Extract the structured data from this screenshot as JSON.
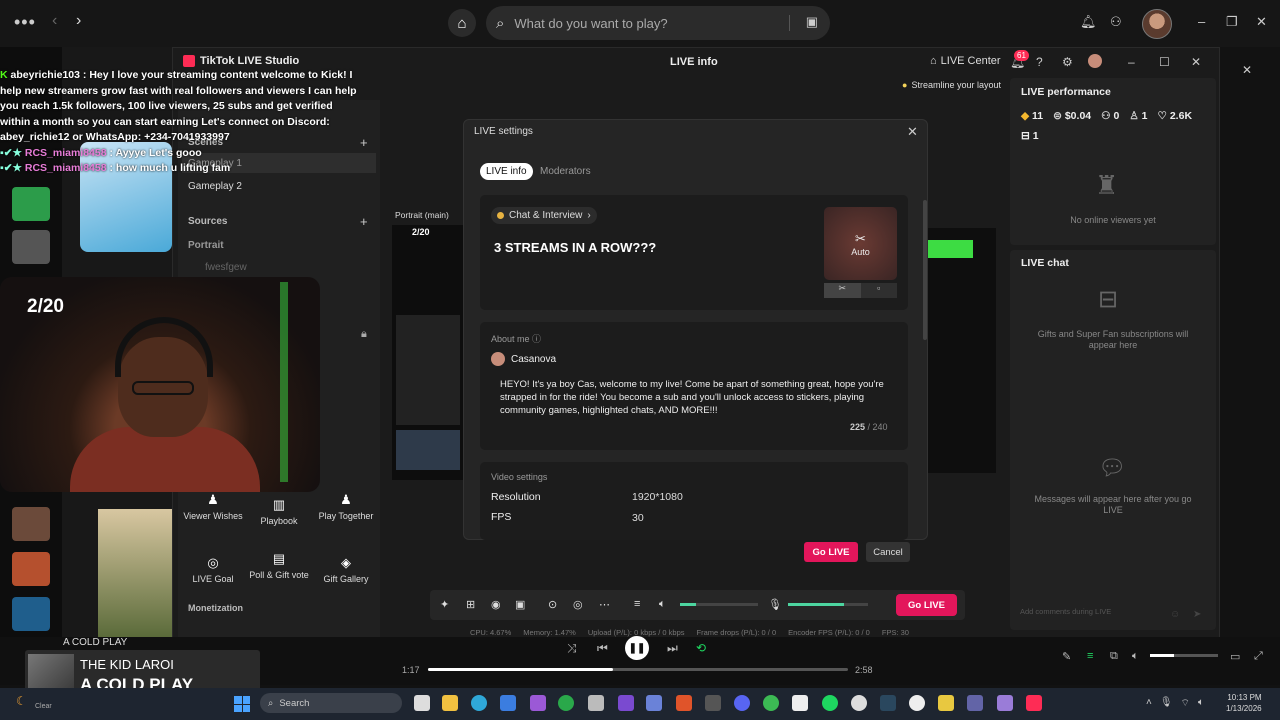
{
  "topbar": {
    "search_placeholder": "What do you want to play?"
  },
  "studio": {
    "app_title": "TikTok LIVE Studio",
    "window_title": "LIVE info",
    "live_center": "LIVE Center",
    "notif_count": "61",
    "streamline": "Streamline your layout",
    "scenes_label": "Scenes",
    "scene_items": [
      "Gameplay 1",
      "Gameplay 2"
    ],
    "sources_label": "Sources",
    "portrait_label": "Portrait",
    "source_item": "fwesfgew",
    "portrait_main": "Portrait (main)",
    "preview_counter": "2/20",
    "tools": [
      {
        "label": "Viewer Wishes",
        "icon": "viewer-wishes-icon"
      },
      {
        "label": "Playbook",
        "icon": "playbook-icon"
      },
      {
        "label": "Play Together",
        "icon": "play-together-icon"
      },
      {
        "label": "LIVE Goal",
        "icon": "live-goal-icon"
      },
      {
        "label": "Poll & Gift vote",
        "icon": "poll-icon"
      },
      {
        "label": "Gift Gallery",
        "icon": "gift-gallery-icon"
      }
    ],
    "monetization_label": "Monetization"
  },
  "chat_overlay": [
    {
      "user": "abeyrichie103",
      "text": " : Hey I love your streaming content welcome to Kick! I help new streamers grow fast with real followers and viewers I can help you reach 1.5k followers, 100 live viewers, 25 subs and get verified within a month so you can start earning Let's connect on Discord: abey_richie12 or WhatsApp: +234-7041933997"
    },
    {
      "user": "RCS_miami8458",
      "text": " : Ayyye Let's gooo"
    },
    {
      "user": "RCS_miami8458",
      "text": " : how much u lifting fam"
    }
  ],
  "overlay_counter": "2/20",
  "modal": {
    "title": "LIVE settings",
    "tabs": [
      "LIVE info",
      "Moderators"
    ],
    "category": "Chat & Interview",
    "live_title": "3 STREAMS IN A ROW???",
    "cover_label": "Auto",
    "about_label": "About me",
    "username": "Casanova",
    "bio": "HEYO! It's ya boy Cas, welcome to my live! Come be apart of something great, hope you're strapped in for the ride! You become a sub and you'll unlock access to stickers, playing community games, highlighted chats, AND MORE!!!",
    "bio_count": "225",
    "bio_max": " / 240",
    "video_settings_label": "Video settings",
    "resolution_label": "Resolution",
    "resolution_value": "1920*1080",
    "fps_label": "FPS",
    "fps_value": "30",
    "go_live": "Go LIVE",
    "cancel": "Cancel"
  },
  "toolbar": {
    "go_live": "Go LIVE",
    "volume_level": 0.2,
    "mic_level": 0.7,
    "stats": [
      "CPU: 4.67%",
      "Memory: 1.47%",
      "Upload (P/L): 0 kbps / 0 kbps",
      "Frame drops (P/L): 0 / 0",
      "Encoder FPS (P/L): 0 / 0",
      "FPS: 30"
    ]
  },
  "performance": {
    "title": "LIVE performance",
    "stats": [
      "11",
      "$0.04",
      "0",
      "1",
      "2.6K"
    ],
    "stats2": "1",
    "empty": "No online viewers yet"
  },
  "live_chat": {
    "title": "LIVE chat",
    "gifts_note": "Gifts and Super Fan subscriptions will appear here",
    "messages_note": "Messages will appear here after you go LIVE",
    "input_placeholder": "Add comments during LIVE"
  },
  "player": {
    "small_title": "A COLD PLAY",
    "artist": "THE KID LAROI",
    "title": "A COLD PLAY",
    "elapsed": "1:17",
    "total": "2:58",
    "progress": 0.44,
    "volume": 0.35
  },
  "taskbar": {
    "weather": "Clear",
    "search": "Search",
    "time": "10:13 PM",
    "date": "1/13/2026"
  },
  "colors": {
    "accent": "#e3165b",
    "tiktok": "#fe2c55",
    "green": "#4dd5a0"
  }
}
